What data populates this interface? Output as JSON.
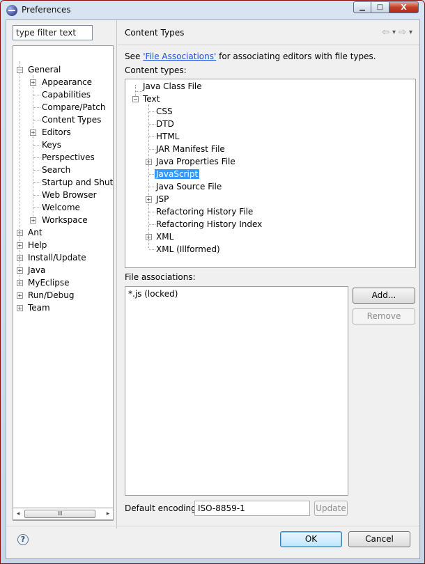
{
  "window": {
    "title": "Preferences",
    "caption": {
      "minimize": "▁",
      "maximize": "□",
      "close": "X"
    }
  },
  "filter": {
    "value": "type filter text"
  },
  "left_tree": {
    "items": [
      {
        "label": "General",
        "expanded": true
      },
      {
        "label": "Appearance",
        "expandable": true
      },
      {
        "label": "Capabilities"
      },
      {
        "label": "Compare/Patch"
      },
      {
        "label": "Content Types",
        "selected": true
      },
      {
        "label": "Editors",
        "expandable": true
      },
      {
        "label": "Keys"
      },
      {
        "label": "Perspectives"
      },
      {
        "label": "Search"
      },
      {
        "label": "Startup and Shutd"
      },
      {
        "label": "Web Browser"
      },
      {
        "label": "Welcome"
      },
      {
        "label": "Workspace",
        "expandable": true
      },
      {
        "label": "Ant",
        "expandable": true
      },
      {
        "label": "Help",
        "expandable": true
      },
      {
        "label": "Install/Update",
        "expandable": true
      },
      {
        "label": "Java",
        "expandable": true
      },
      {
        "label": "MyEclipse",
        "expandable": true
      },
      {
        "label": "Run/Debug",
        "expandable": true
      },
      {
        "label": "Team",
        "expandable": true
      }
    ],
    "scroll_thumb": "III"
  },
  "page": {
    "title": "Content Types",
    "assoc_prefix": "See ",
    "assoc_link": "'File Associations'",
    "assoc_suffix": " for associating editors with file types.",
    "content_types_label": "Content types:",
    "content_types": [
      {
        "label": "Java Class File"
      },
      {
        "label": "Text",
        "expanded": true
      },
      {
        "label": "CSS"
      },
      {
        "label": "DTD"
      },
      {
        "label": "HTML"
      },
      {
        "label": "JAR Manifest File"
      },
      {
        "label": "Java Properties File",
        "expandable": true
      },
      {
        "label": "JavaScript",
        "selected": true
      },
      {
        "label": "Java Source File"
      },
      {
        "label": "JSP",
        "expandable": true
      },
      {
        "label": "Refactoring History File"
      },
      {
        "label": "Refactoring History Index"
      },
      {
        "label": "XML",
        "expandable": true
      },
      {
        "label": "XML (Illformed)"
      }
    ],
    "file_assoc_label": "File associations:",
    "file_assoc_items": [
      "*.js (locked)"
    ],
    "add_label": "Add...",
    "remove_label": "Remove",
    "encoding_label": "Default encoding:",
    "encoding_value": "ISO-8859-1",
    "update_label": "Update"
  },
  "footer": {
    "help": "?",
    "ok_label": "OK",
    "cancel_label": "Cancel"
  },
  "nav": {
    "back": "⇦",
    "back_menu": "▾",
    "forward": "⇨",
    "forward_menu": "▾"
  }
}
